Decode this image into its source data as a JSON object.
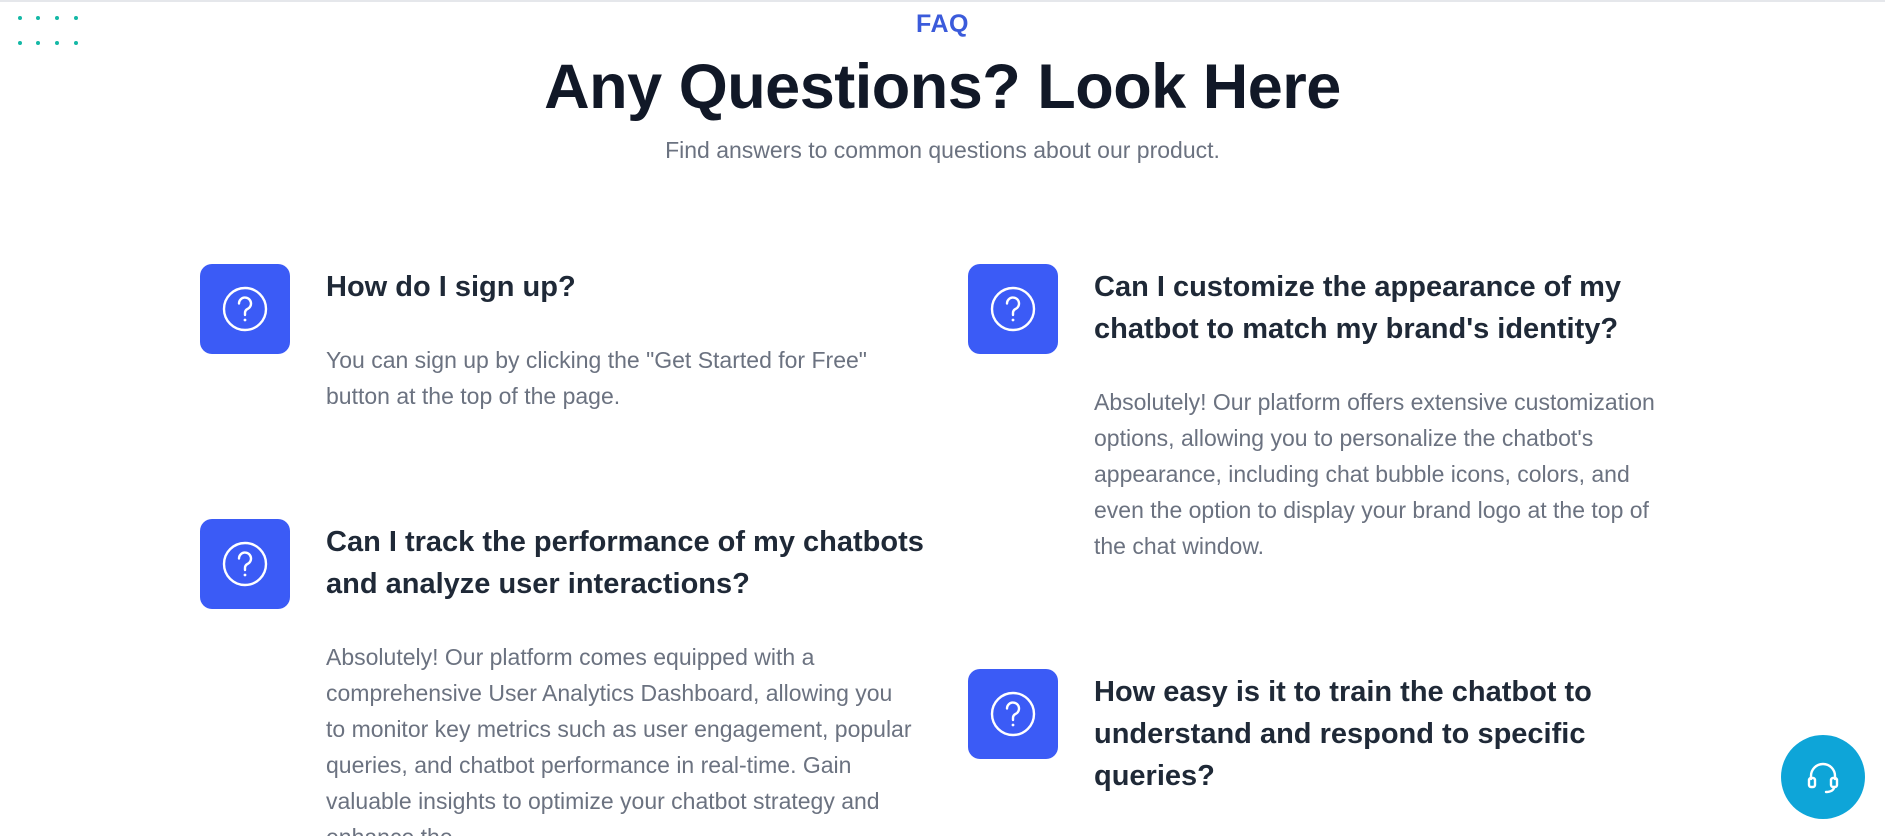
{
  "header": {
    "eyebrow": "FAQ",
    "title": "Any Questions? Look Here",
    "subtitle": "Find answers to common questions about our product."
  },
  "faqs": [
    {
      "icon": "question-circle-icon",
      "question": "How do I sign up?",
      "answer": "You can sign up by clicking the \"Get Started for Free\" button at the top of the page."
    },
    {
      "icon": "question-circle-icon",
      "question": "Can I customize the appearance of my chatbot to match my brand's identity?",
      "answer": "Absolutely! Our platform offers extensive customization options, allowing you to personalize the chatbot's appearance, including chat bubble icons, colors, and even the option to display your brand logo at the top of the chat window."
    },
    {
      "icon": "question-circle-icon",
      "question": "Can I track the performance of my chatbots and analyze user interactions?",
      "answer": "Absolutely! Our platform comes equipped with a comprehensive User Analytics Dashboard, allowing you to monitor key metrics such as user engagement, popular queries, and chatbot performance in real-time. Gain valuable insights to optimize your chatbot strategy and enhance the"
    },
    {
      "icon": "question-circle-icon",
      "question": "How easy is it to train the chatbot to understand and respond to specific queries?",
      "answer": ""
    }
  ],
  "support": {
    "icon": "headset-icon"
  },
  "colors": {
    "accent": "#3b5bf6",
    "eyebrow": "#3b5bdb",
    "heading": "#111827",
    "body": "#6b7280",
    "support": "#0ea5d8",
    "dots": "#14b8a6"
  }
}
